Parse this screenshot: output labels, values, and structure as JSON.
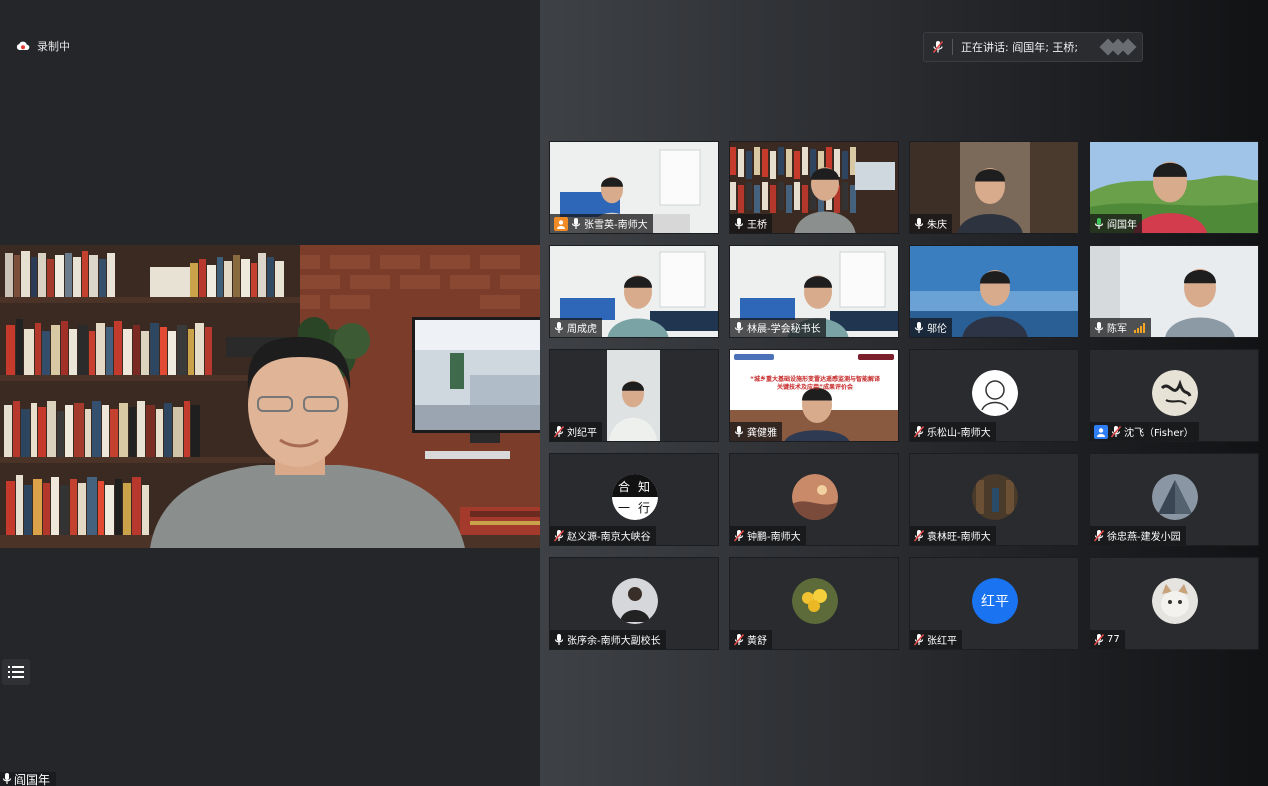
{
  "recording": {
    "label": "录制中"
  },
  "talking": {
    "label": "正在讲话: 阎国年; 王桥;"
  },
  "main_speaker": {
    "name": "阎国年"
  },
  "participants": [
    {
      "name": "张雪英-南师大",
      "mic": "on",
      "badge": "host",
      "scene": "office",
      "col": 0,
      "row": 0
    },
    {
      "name": "王桥",
      "mic": "on",
      "scene": "books",
      "col": 1,
      "row": 0
    },
    {
      "name": "朱庆",
      "mic": "on",
      "scene": "study",
      "col": 2,
      "row": 0
    },
    {
      "name": "阎国年",
      "mic": "speaking",
      "scene": "hills",
      "col": 3,
      "row": 0
    },
    {
      "name": "周成虎",
      "mic": "on",
      "scene": "office2",
      "col": 0,
      "row": 1
    },
    {
      "name": "林晨-学会秘书长",
      "mic": "on",
      "scene": "office2",
      "col": 1,
      "row": 1
    },
    {
      "name": "邬伦",
      "mic": "on",
      "scene": "sky",
      "col": 2,
      "row": 1
    },
    {
      "name": "陈军",
      "mic": "on",
      "signal": true,
      "scene": "room",
      "col": 3,
      "row": 1
    },
    {
      "name": "刘纪平",
      "mic": "muted",
      "scene": "portrait",
      "col": 0,
      "row": 2
    },
    {
      "name": "龚健雅",
      "mic": "on",
      "scene": "banner",
      "col": 1,
      "row": 2,
      "banner_text": [
        "“城乡重大基础设施形变雷达遥感监测与智能解译",
        "关键技术及应用”成果评价会"
      ]
    },
    {
      "name": "乐松山-南师大",
      "mic": "muted",
      "avatar": "drawing",
      "col": 2,
      "row": 2
    },
    {
      "name": "沈飞（Fisher）",
      "mic": "muted",
      "badge": "cohost",
      "avatar": "calligraphy",
      "col": 3,
      "row": 2
    },
    {
      "name": "赵义源-南京大峡谷",
      "mic": "muted",
      "avatar": "heyi",
      "avatar_text": [
        "合",
        "知",
        "一",
        "行"
      ],
      "col": 0,
      "row": 3
    },
    {
      "name": "钟鹏-南师大",
      "mic": "muted",
      "avatar": "sunset",
      "col": 1,
      "row": 3
    },
    {
      "name": "袁林旺-南师大",
      "mic": "muted",
      "avatar": "library",
      "col": 2,
      "row": 3
    },
    {
      "name": "徐忠燕-建发小园",
      "mic": "muted",
      "avatar": "pyramid",
      "col": 3,
      "row": 3
    },
    {
      "name": "张序余-南师大副校长",
      "mic": "on",
      "avatar": "person",
      "col": 0,
      "row": 4
    },
    {
      "name": "黄舒",
      "mic": "muted",
      "avatar": "flowers",
      "col": 1,
      "row": 4
    },
    {
      "name": "张红平",
      "mic": "muted",
      "avatar": "text",
      "avatar_text": "红平",
      "col": 2,
      "row": 4
    },
    {
      "name": "77",
      "mic": "muted",
      "avatar": "cat",
      "col": 3,
      "row": 4
    }
  ],
  "colors": {
    "accent_blue": "#1a73f0",
    "speaking_green": "#3fc55b",
    "muted_red": "#e04848",
    "host_orange": "#f08a24"
  }
}
